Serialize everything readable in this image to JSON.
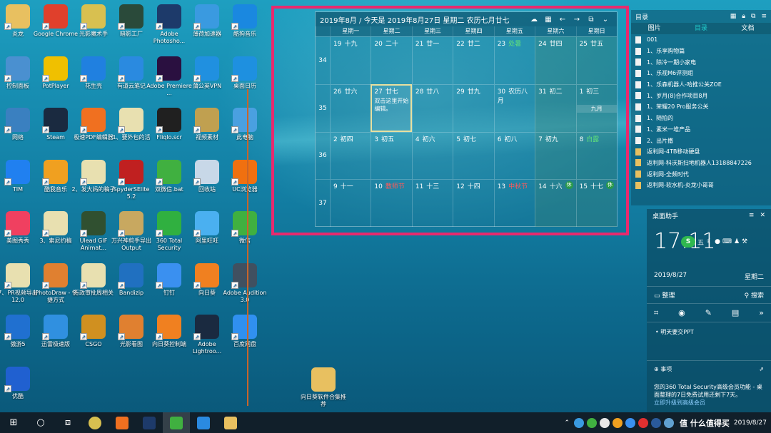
{
  "desktop_icons": [
    {
      "label": "炎龙",
      "icon": "folder-icon",
      "color": "#e8c060"
    },
    {
      "label": "Google Chrome",
      "icon": "chrome-icon",
      "color": "#e0402c"
    },
    {
      "label": "光影魔术手",
      "icon": "camera-icon",
      "color": "#d8c050"
    },
    {
      "label": "暗影工厂",
      "icon": "video-icon",
      "color": "#2a4a3a"
    },
    {
      "label": "Adobe Photosho...",
      "icon": "photoshop-icon",
      "color": "#1d3a6a"
    },
    {
      "label": "薄荷加速器",
      "icon": "mint-icon",
      "color": "#3a9ae0"
    },
    {
      "label": "酷狗音乐",
      "icon": "kugou-icon",
      "color": "#1a88e0"
    },
    {
      "label": "控制面板",
      "icon": "control-panel-icon",
      "color": "#4a90d0"
    },
    {
      "label": "PotPlayer",
      "icon": "potplayer-icon",
      "color": "#f0c000"
    },
    {
      "label": "花生壳",
      "icon": "cube-icon",
      "color": "#2080e0"
    },
    {
      "label": "有道云笔记",
      "icon": "note-icon",
      "color": "#2a8ae0"
    },
    {
      "label": "Adobe Premiere ...",
      "icon": "premiere-icon",
      "color": "#2a1040"
    },
    {
      "label": "蒲公英VPN",
      "icon": "vpn-icon",
      "color": "#2090e0"
    },
    {
      "label": "桌面日历",
      "icon": "calendar-grid-icon",
      "color": "#1e90e0"
    },
    {
      "label": "网络",
      "icon": "network-icon",
      "color": "#3a80c0"
    },
    {
      "label": "Steam",
      "icon": "steam-icon",
      "color": "#1a2a40"
    },
    {
      "label": "极速PDF编辑器",
      "icon": "pdf-icon",
      "color": "#f07020"
    },
    {
      "label": "1、要外包的活",
      "icon": "doc-icon",
      "color": "#e8e0b0"
    },
    {
      "label": "Fliqlo.scr",
      "icon": "clock-icon",
      "color": "#202020"
    },
    {
      "label": "视频素材",
      "icon": "folder-icon",
      "color": "#c0a050"
    },
    {
      "label": "此电脑",
      "icon": "computer-icon",
      "color": "#4aa0e0"
    },
    {
      "label": "TIM",
      "icon": "tim-icon",
      "color": "#2080f0"
    },
    {
      "label": "酷我音乐",
      "icon": "kuwo-icon",
      "color": "#f0a020"
    },
    {
      "label": "2、发大妈的稿子",
      "icon": "doc-icon",
      "color": "#e8e0b0"
    },
    {
      "label": "SpyderSElite 5.2",
      "icon": "spyder-icon",
      "color": "#c02020"
    },
    {
      "label": "双微信.bat",
      "icon": "wechat-icon",
      "color": "#40b040"
    },
    {
      "label": "回收站",
      "icon": "trash-icon",
      "color": "#c8d8e8"
    },
    {
      "label": "UC浏览器",
      "icon": "uc-icon",
      "color": "#f07010"
    },
    {
      "label": "美图秀秀",
      "icon": "meitu-icon",
      "color": "#f04060"
    },
    {
      "label": "3、索尼约稿",
      "icon": "doc-icon",
      "color": "#e8e0b0"
    },
    {
      "label": "Ulead GIF Animat...",
      "icon": "gif-icon",
      "color": "#305030"
    },
    {
      "label": "万兴神剪手导出Output",
      "icon": "folder-icon",
      "color": "#c8a860"
    },
    {
      "label": "360 Total Security",
      "icon": "360-icon",
      "color": "#30b040"
    },
    {
      "label": "阿里旺旺",
      "icon": "wangwang-icon",
      "color": "#4ab0f0"
    },
    {
      "label": "微信",
      "icon": "wechat-icon",
      "color": "#40b040"
    },
    {
      "label": "7、PR视频导出12.0",
      "icon": "doc-icon",
      "color": "#e8e0b0"
    },
    {
      "label": "iPhotoDraw - 快捷方式",
      "icon": "iphotodraw-icon",
      "color": "#e08030"
    },
    {
      "label": "行政审批周相关",
      "icon": "doc-icon",
      "color": "#e8e0b0"
    },
    {
      "label": "Bandizip",
      "icon": "bandizip-icon",
      "color": "#2070c0"
    },
    {
      "label": "钉钉",
      "icon": "dingtalk-icon",
      "color": "#3a90f0"
    },
    {
      "label": "向日葵",
      "icon": "sunflower-icon",
      "color": "#f08020"
    },
    {
      "label": "Adobe Audition 3.0",
      "icon": "audition-icon",
      "color": "#405060"
    },
    {
      "label": "傲游5",
      "icon": "maxthon-icon",
      "color": "#2070d0"
    },
    {
      "label": "迅雷极速版",
      "icon": "xunlei-icon",
      "color": "#3090e0"
    },
    {
      "label": "CSGO",
      "icon": "csgo-icon",
      "color": "#d09020"
    },
    {
      "label": "光影看图",
      "icon": "viewer-icon",
      "color": "#e08030"
    },
    {
      "label": "向日葵控制端",
      "icon": "sunflower-icon",
      "color": "#f08020"
    },
    {
      "label": "Adobe Lightroo...",
      "icon": "lightroom-icon",
      "color": "#1a2a40"
    },
    {
      "label": "百度网盘",
      "icon": "baidu-disk-icon",
      "color": "#3090f0"
    },
    {
      "label": "优酷",
      "icon": "youku-icon",
      "color": "#2060d0"
    }
  ],
  "extra_icon": {
    "label": "向日葵软件合集推荐",
    "icon": "folder-icon"
  },
  "calendar": {
    "title": "2019年8月 / 今天是 2019年8月27日 星期二 农历七月廿七",
    "weekdays": [
      "星期一",
      "星期二",
      "星期三",
      "星期四",
      "星期五",
      "星期六",
      "星期日"
    ],
    "weeks": [
      {
        "num": "34",
        "days": [
          [
            "19",
            "十九"
          ],
          [
            "20",
            "二十"
          ],
          [
            "21",
            "廿一"
          ],
          [
            "22",
            "廿二"
          ],
          [
            "23",
            "处暑"
          ],
          [
            "24",
            "廿四"
          ],
          [
            "25",
            "廿五"
          ]
        ]
      },
      {
        "num": "35",
        "days": [
          [
            "26",
            "廿六"
          ],
          [
            "27",
            "廿七"
          ],
          [
            "28",
            "廿八"
          ],
          [
            "29",
            "廿九"
          ],
          [
            "30",
            "农历八月"
          ],
          [
            "31",
            "初二"
          ],
          [
            "1",
            "初三"
          ]
        ]
      },
      {
        "num": "36",
        "days": [
          [
            "2",
            "初四"
          ],
          [
            "3",
            "初五"
          ],
          [
            "4",
            "初六"
          ],
          [
            "5",
            "初七"
          ],
          [
            "6",
            "初八"
          ],
          [
            "7",
            "初九"
          ],
          [
            "8",
            "白露"
          ]
        ]
      },
      {
        "num": "37",
        "days": [
          [
            "9",
            "十一"
          ],
          [
            "10",
            "教师节"
          ],
          [
            "11",
            "十三"
          ],
          [
            "12",
            "十四"
          ],
          [
            "13",
            "中秋节"
          ],
          [
            "14",
            "十六"
          ],
          [
            "15",
            "十七"
          ]
        ]
      }
    ],
    "today_note": "双击这里开始编辑。",
    "month_tag": "九月",
    "holiday_mark": "休"
  },
  "toc": {
    "title": "目录",
    "tabs": [
      "图片",
      "目录",
      "文档"
    ],
    "items": [
      "001",
      "1、乐享购物篇",
      "1、除冷一期小家电",
      "1、乐视M6评测组",
      "1、乐森机器人-哈推公关ZOE",
      "1、岁月(8)合作项目8月",
      "1、荣耀20 Pro服务公关",
      "1、随拍的",
      "1、素米一堆产品",
      "2、出片撒",
      "返利网-4TB移动硬盘",
      "返利网-科沃斯扫地机器人13188847226",
      "返利网-全频时代",
      "返利网-软水机-炎龙小哥哥"
    ]
  },
  "assistant": {
    "title": "桌面助手",
    "time": "17:11",
    "date": "2019/8/27",
    "weekday": "星期二",
    "weather_badge": "五",
    "organize": "整理",
    "search": "搜索",
    "todo": "明天要交PPT",
    "events": "事项",
    "notice": "您的360 Total Security高级会员功能 - 桌面整理的7日免费试用还剩下7天。",
    "upgrade": "立即升级到高级会员"
  },
  "taskbar": {
    "date": "2019/8/27",
    "watermark": "值 什么值得买"
  }
}
